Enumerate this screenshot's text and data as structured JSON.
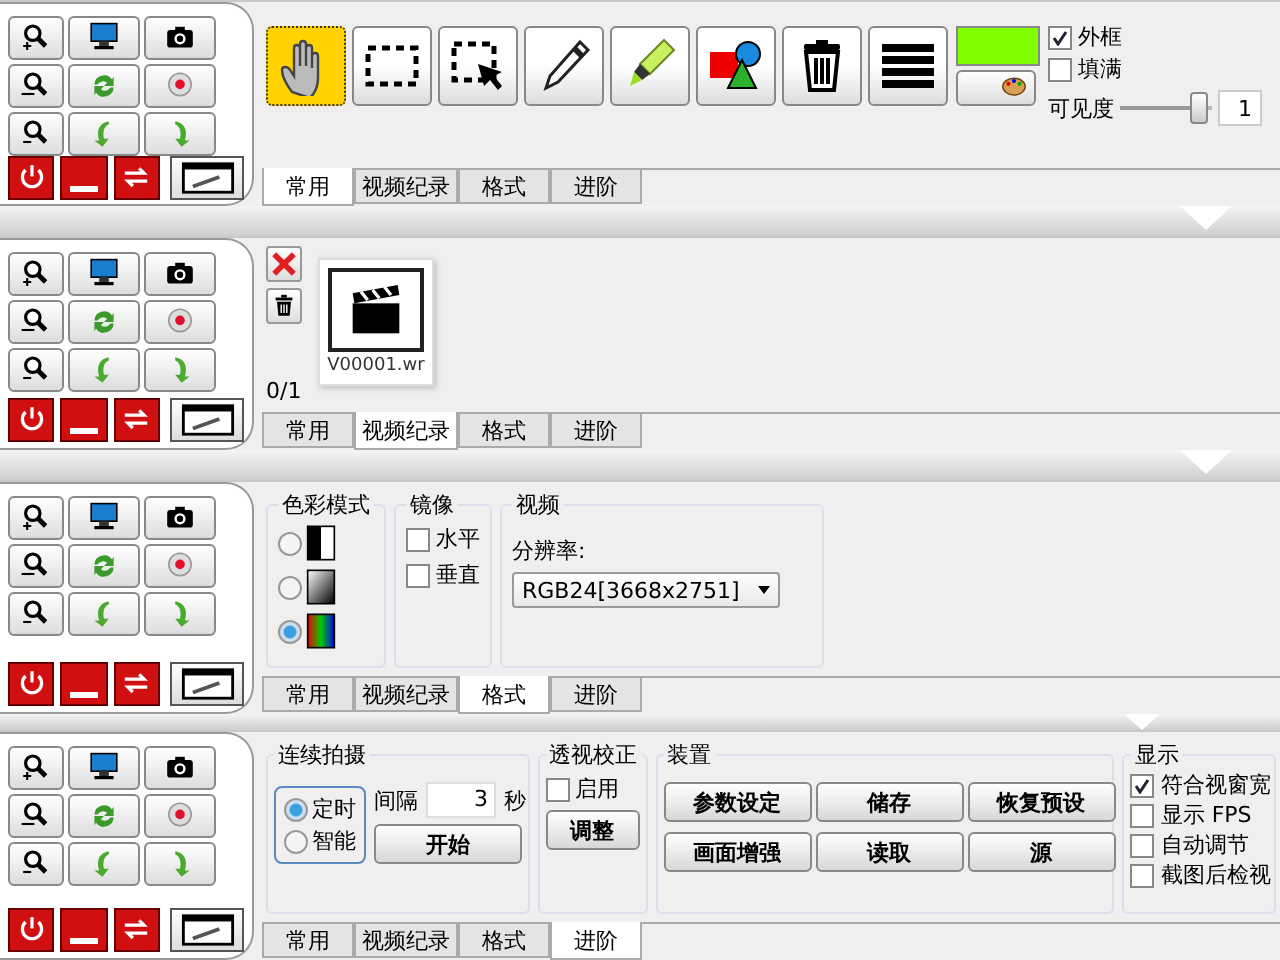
{
  "panels": [
    {
      "kind": "common",
      "tools": [
        {
          "kind": "hand",
          "selected": true
        },
        {
          "kind": "rect",
          "selected": false
        },
        {
          "kind": "select",
          "selected": false
        },
        {
          "kind": "pen",
          "selected": false
        },
        {
          "kind": "marker",
          "selected": false
        },
        {
          "kind": "shapes",
          "selected": false
        },
        {
          "kind": "trash",
          "selected": false
        },
        {
          "kind": "lines",
          "selected": false
        }
      ],
      "color": "#80ff00",
      "checkboxes": [
        {
          "label": "外框",
          "checked": true
        },
        {
          "label": "填满",
          "checked": false
        }
      ],
      "opacity": {
        "label": "可见度",
        "level": 0.95,
        "value": "1"
      },
      "tabs": [
        {
          "label": "常用",
          "selected": true
        },
        {
          "label": "视频纪录",
          "selected": false
        },
        {
          "label": "格式",
          "selected": false
        },
        {
          "label": "进阶",
          "selected": false
        }
      ]
    },
    {
      "kind": "video",
      "file": "V00001.wr",
      "count": "0/1",
      "tabs": [
        {
          "label": "常用",
          "selected": false
        },
        {
          "label": "视频纪录",
          "selected": true
        },
        {
          "label": "格式",
          "selected": false
        },
        {
          "label": "进阶",
          "selected": false
        }
      ]
    },
    {
      "kind": "format",
      "color_mode": {
        "title": "色彩模式",
        "options": [
          {
            "kind": "bw",
            "selected": false
          },
          {
            "kind": "gray",
            "selected": false
          },
          {
            "kind": "rgb",
            "selected": true
          }
        ]
      },
      "mirror": {
        "title": "镜像",
        "options": [
          {
            "label": "水平",
            "checked": false
          },
          {
            "label": "垂直",
            "checked": false
          }
        ]
      },
      "video": {
        "title": "视频",
        "label": "分辨率:",
        "value": "RGB24[3668x2751]"
      },
      "tabs": [
        {
          "label": "常用",
          "selected": false
        },
        {
          "label": "视频纪录",
          "selected": false
        },
        {
          "label": "格式",
          "selected": true
        },
        {
          "label": "进阶",
          "selected": false
        }
      ]
    },
    {
      "kind": "advanced",
      "burst": {
        "title": "连续拍摄",
        "modes": [
          {
            "label": "定时",
            "selected": true
          },
          {
            "label": "智能",
            "selected": false
          }
        ],
        "interval_label": "间隔",
        "interval": "3",
        "unit": "秒",
        "button": "开始"
      },
      "perspective": {
        "title": "透视校正",
        "checkbox": {
          "label": "启用",
          "checked": false
        },
        "button": "调整"
      },
      "device": {
        "title": "装置",
        "buttons": [
          "参数设定",
          "储存",
          "恢复预设",
          "画面增强",
          "读取",
          "源"
        ]
      },
      "display": {
        "title": "显示",
        "options": [
          {
            "label": "符合视窗宽",
            "checked": true
          },
          {
            "label": "显示 FPS",
            "checked": false
          },
          {
            "label": "自动调节",
            "checked": false
          },
          {
            "label": "截图后检视",
            "checked": false
          }
        ]
      },
      "tabs": [
        {
          "label": "常用",
          "selected": false
        },
        {
          "label": "视频纪录",
          "selected": false
        },
        {
          "label": "格式",
          "selected": false
        },
        {
          "label": "进阶",
          "selected": true
        }
      ]
    }
  ]
}
